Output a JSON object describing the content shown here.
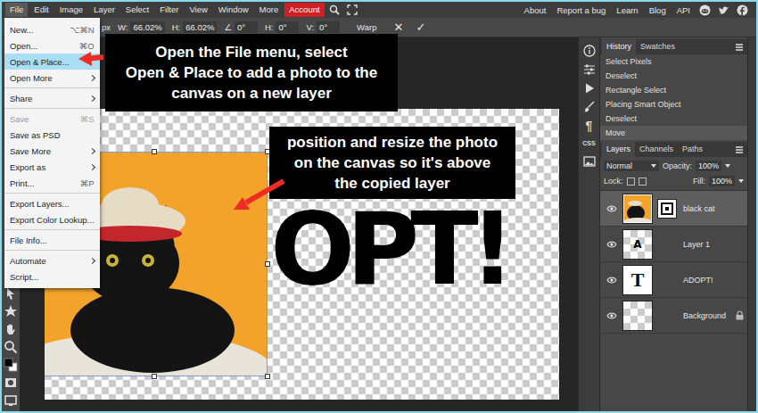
{
  "menubar": {
    "items": [
      {
        "label": "File",
        "selected": true,
        "highlighted": false
      },
      {
        "label": "Edit",
        "selected": false,
        "highlighted": false
      },
      {
        "label": "Image",
        "selected": false,
        "highlighted": false
      },
      {
        "label": "Layer",
        "selected": false,
        "highlighted": false
      },
      {
        "label": "Select",
        "selected": false,
        "highlighted": false
      },
      {
        "label": "Filter",
        "selected": false,
        "highlighted": false
      },
      {
        "label": "View",
        "selected": false,
        "highlighted": false
      },
      {
        "label": "Window",
        "selected": false,
        "highlighted": false
      },
      {
        "label": "More",
        "selected": false,
        "highlighted": false
      },
      {
        "label": "Account",
        "selected": false,
        "highlighted": true
      }
    ],
    "links": [
      "About",
      "Report a bug",
      "Learn",
      "Blog",
      "API"
    ]
  },
  "options_bar": {
    "unit": "px",
    "fields": [
      {
        "label": "W:",
        "value": "66.02%"
      },
      {
        "label": "H:",
        "value": "66.02%"
      },
      {
        "label": "∠",
        "value": "0°"
      },
      {
        "label": "H:",
        "value": "0°"
      },
      {
        "label": "V:",
        "value": "0°"
      }
    ],
    "warp": "Warp",
    "cancel": "✕",
    "commit": "✓"
  },
  "file_menu": {
    "items": [
      {
        "label": "New...",
        "shortcut": "⌥⌘N",
        "submenu": false,
        "disabled": false,
        "selected": false,
        "separator_before": false
      },
      {
        "label": "Open...",
        "shortcut": "⌘O",
        "submenu": false,
        "disabled": false,
        "selected": false,
        "separator_before": false
      },
      {
        "label": "Open & Place...",
        "shortcut": "",
        "submenu": false,
        "disabled": false,
        "selected": true,
        "separator_before": false
      },
      {
        "label": "Open More",
        "shortcut": "",
        "submenu": true,
        "disabled": false,
        "selected": false,
        "separator_before": false
      },
      {
        "label": "Share",
        "shortcut": "",
        "submenu": true,
        "disabled": false,
        "selected": false,
        "separator_before": true
      },
      {
        "label": "Save",
        "shortcut": "⌘S",
        "submenu": false,
        "disabled": true,
        "selected": false,
        "separator_before": true
      },
      {
        "label": "Save as PSD",
        "shortcut": "",
        "submenu": false,
        "disabled": false,
        "selected": false,
        "separator_before": false
      },
      {
        "label": "Save More",
        "shortcut": "",
        "submenu": true,
        "disabled": false,
        "selected": false,
        "separator_before": false
      },
      {
        "label": "Export as",
        "shortcut": "",
        "submenu": true,
        "disabled": false,
        "selected": false,
        "separator_before": false
      },
      {
        "label": "Print...",
        "shortcut": "⌘P",
        "submenu": false,
        "disabled": false,
        "selected": false,
        "separator_before": false
      },
      {
        "label": "Export Layers...",
        "shortcut": "",
        "submenu": false,
        "disabled": false,
        "selected": false,
        "separator_before": true
      },
      {
        "label": "Export Color Lookup...",
        "shortcut": "",
        "submenu": false,
        "disabled": false,
        "selected": false,
        "separator_before": false
      },
      {
        "label": "File Info...",
        "shortcut": "",
        "submenu": false,
        "disabled": false,
        "selected": false,
        "separator_before": true
      },
      {
        "label": "Automate",
        "shortcut": "",
        "submenu": true,
        "disabled": false,
        "selected": false,
        "separator_before": true
      },
      {
        "label": "Script...",
        "shortcut": "",
        "submenu": false,
        "disabled": false,
        "selected": false,
        "separator_before": false
      }
    ]
  },
  "canvas": {
    "text": "OPT!"
  },
  "side_icons": {
    "paragraph": "¶",
    "css": "CSS"
  },
  "history": {
    "tabs": [
      {
        "label": "History",
        "selected": true
      },
      {
        "label": "Swatches",
        "selected": false
      }
    ],
    "items": [
      {
        "label": "Select Pixels",
        "selected": false
      },
      {
        "label": "Deselect",
        "selected": false
      },
      {
        "label": "Rectangle Select",
        "selected": false
      },
      {
        "label": "Placing Smart Object",
        "selected": false
      },
      {
        "label": "Deselect",
        "selected": false
      },
      {
        "label": "Move",
        "selected": true
      }
    ]
  },
  "layers": {
    "tabs": [
      {
        "label": "Layers",
        "selected": true
      },
      {
        "label": "Channels",
        "selected": false
      },
      {
        "label": "Paths",
        "selected": false
      }
    ],
    "blend_mode": "Normal",
    "opacity_label": "Opacity:",
    "opacity": "100%",
    "lock_label": "Lock:",
    "fill_label": "Fill:",
    "fill": "100%",
    "items": [
      {
        "name": "black cat",
        "kind": "smart",
        "thumb_text": "",
        "selected": true,
        "visible": true,
        "locked": false
      },
      {
        "name": "Layer 1",
        "kind": "raster",
        "thumb_text": "A",
        "selected": false,
        "visible": true,
        "locked": false
      },
      {
        "name": "ADOPT!",
        "kind": "text",
        "thumb_text": "T",
        "selected": false,
        "visible": true,
        "locked": false
      },
      {
        "name": "Background",
        "kind": "raster",
        "thumb_text": "",
        "selected": false,
        "visible": true,
        "locked": true
      }
    ]
  },
  "annotations": [
    {
      "lines": [
        "Open the File menu, select",
        "Open & Place to add a photo to the",
        "canvas on a new layer"
      ]
    },
    {
      "lines": [
        "position and resize the photo",
        "on the canvas so it's above",
        "the copied layer"
      ]
    }
  ]
}
